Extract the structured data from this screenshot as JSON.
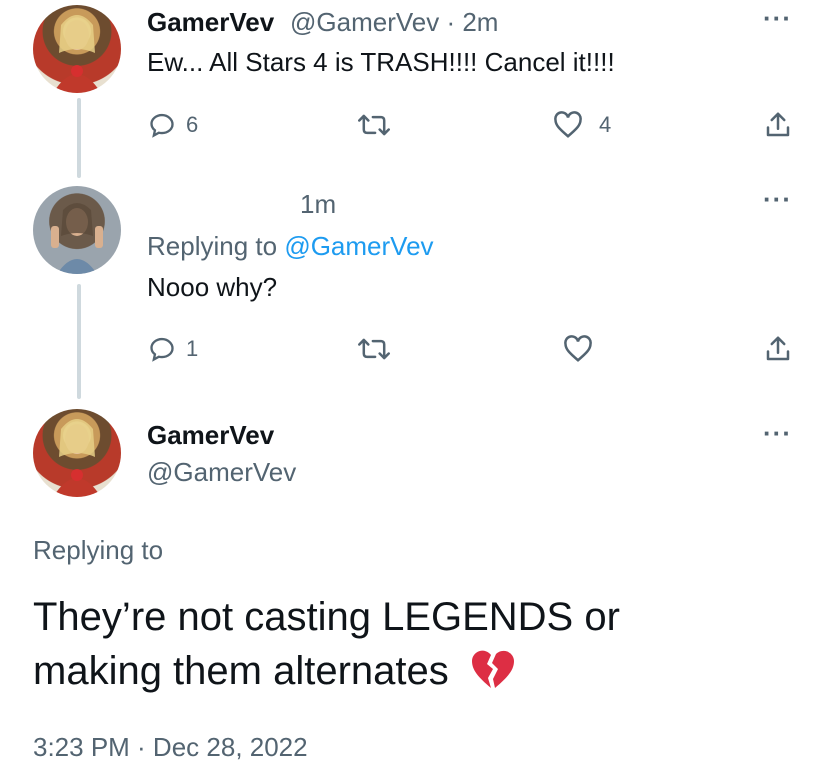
{
  "tweet1": {
    "name": "GamerVev",
    "handle_time": "@GamerVev · 2m",
    "text": "Ew... All Stars 4 is TRASH!!!! Cancel it!!!!",
    "more": "···",
    "replies": "6",
    "likes": "4"
  },
  "tweet2": {
    "time": "1m",
    "replying_prefix": "Replying to ",
    "replying_handle": "@GamerVev",
    "text": "Nooo why?",
    "more": "···",
    "replies": "1"
  },
  "main": {
    "name": "GamerVev",
    "handle": "@GamerVev",
    "more": "···",
    "replying": "Replying to",
    "text_line1": "They’re not casting LEGENDS or",
    "text_line2": "making them alternates",
    "emoji": "💔",
    "timestamp": "3:23 PM · Dec 28, 2022"
  },
  "icons": {
    "reply": "reply-icon",
    "retweet": "retweet-icon",
    "like": "heart-icon",
    "share": "share-icon"
  },
  "colors": {
    "text": "#0f1419",
    "secondary": "#536471",
    "link": "#1d9bf0",
    "thread_line": "#cfd9de"
  }
}
